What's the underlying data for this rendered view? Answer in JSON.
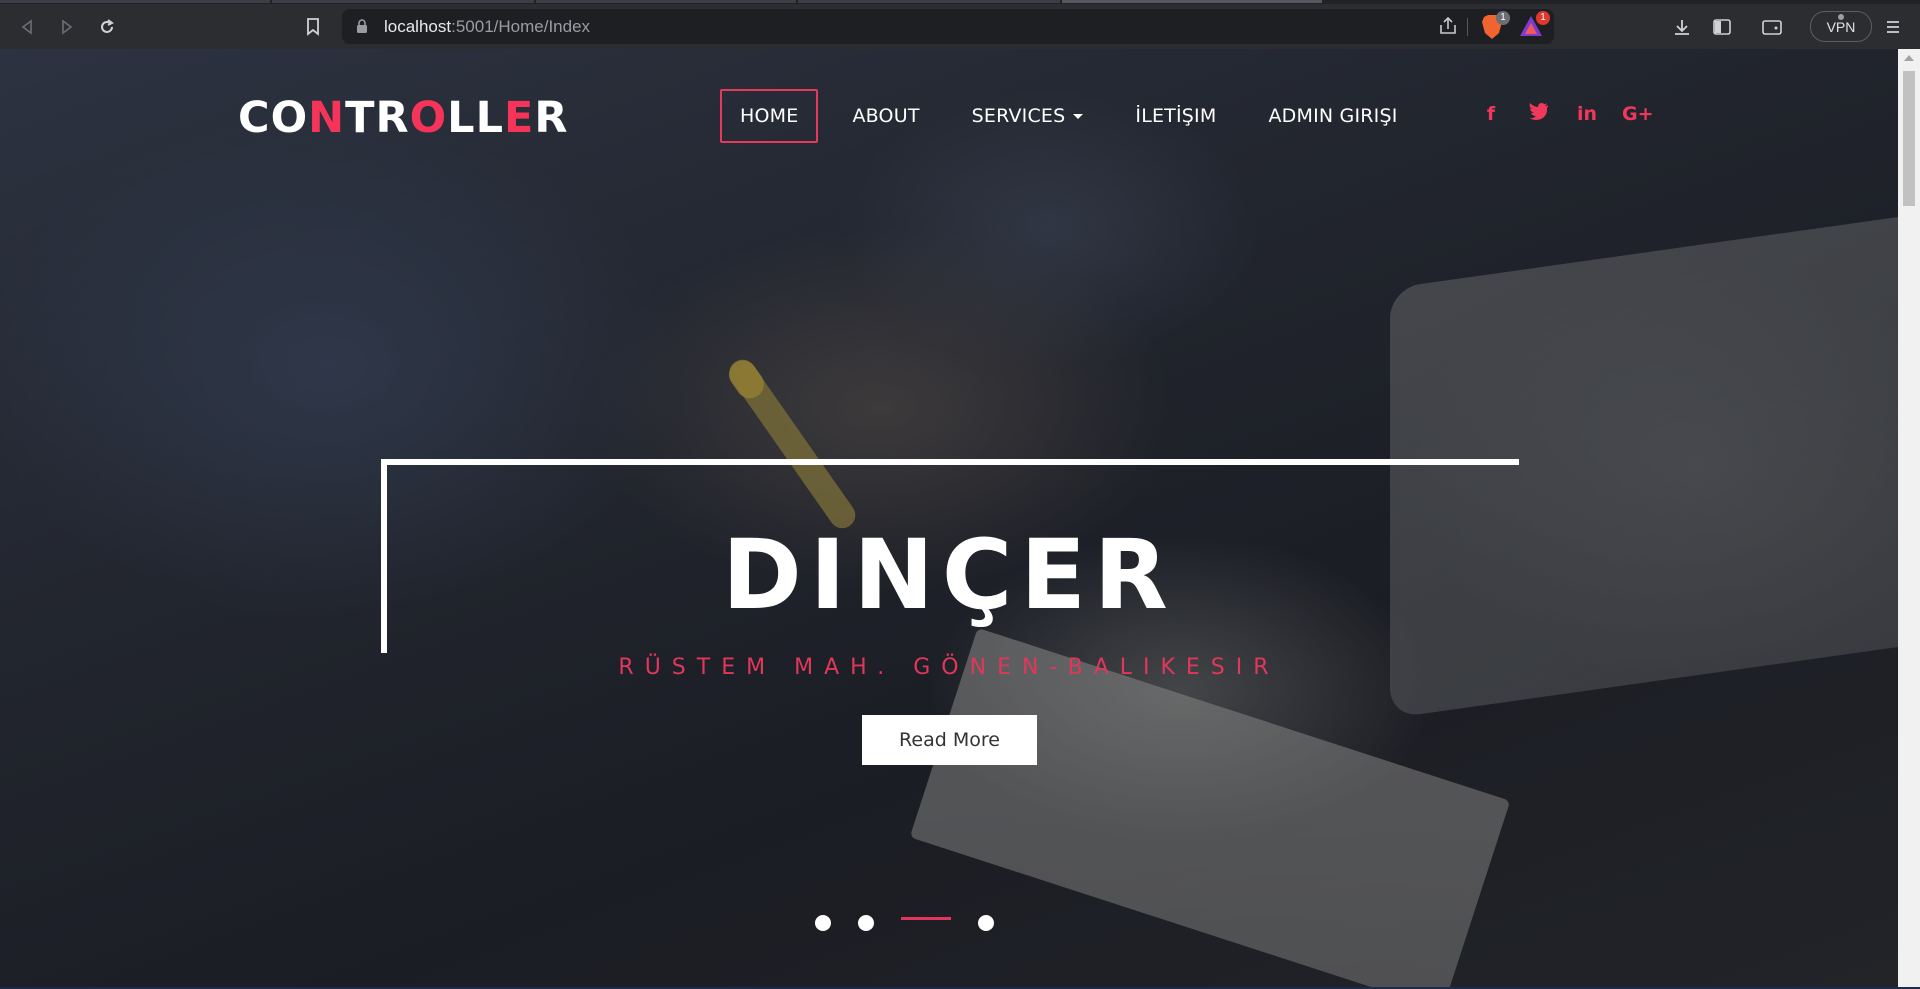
{
  "browser": {
    "url_host": "localhost",
    "url_rest": ":5001/Home/Index",
    "brave_badge": "1",
    "rewards_badge": "1",
    "vpn_label": "VPN"
  },
  "site": {
    "logo_letters": [
      "C",
      "O",
      "N",
      "T",
      "R",
      "O",
      "L",
      "L",
      "E",
      "R"
    ],
    "nav": {
      "home": "HOME",
      "about": "ABOUT",
      "services": "SERVICES",
      "contact": "İLETİŞIM",
      "admin": "ADMIN GIRIŞI"
    },
    "social": {
      "facebook": "f",
      "twitter": "t",
      "linkedin": "in",
      "googleplus": "G+"
    },
    "hero": {
      "title": "DINÇER",
      "subtitle": "RÜSTEM MAH. GÖNEN-BALIKESIR",
      "button": "Read More"
    },
    "slider": {
      "active_index": 2,
      "count": 4
    }
  },
  "colors": {
    "accent": "#f0385c",
    "chrome_bg": "#2b2d31",
    "address_bg": "#1e1f22"
  }
}
